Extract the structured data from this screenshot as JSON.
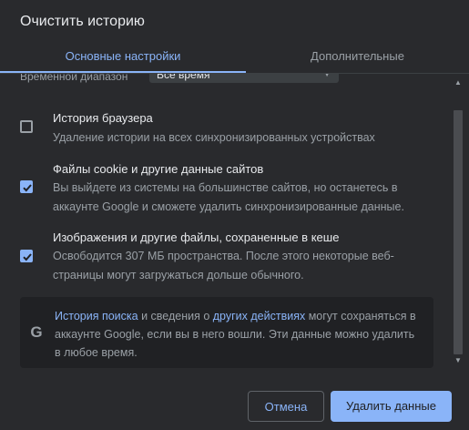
{
  "dialog": {
    "title": "Очистить историю"
  },
  "tabs": {
    "basic": "Основные настройки",
    "advanced": "Дополнительные"
  },
  "time_range": {
    "label": "Временной диапазон",
    "value": "Все время"
  },
  "items": [
    {
      "title": "История браузера",
      "description": "Удаление истории на всех синхронизированных устройствах",
      "checked": false
    },
    {
      "title": "Файлы cookie и другие данные сайтов",
      "description": "Вы выйдете из системы на большинстве сайтов, но останетесь в аккаунте Google и сможете удалить синхронизированные данные.",
      "checked": true
    },
    {
      "title": "Изображения и другие файлы, сохраненные в кеше",
      "description": "Освободится 307 МБ пространства. После этого некоторые веб-страницы могут загружаться дольше обычного.",
      "checked": true
    }
  ],
  "info": {
    "link_search": "История поиска",
    "text_part1": " и сведения о ",
    "link_other": "других действиях",
    "text_part2": " могут сохраняться в аккаунте Google, если вы в него вошли. Эти данные можно удалить в любое время."
  },
  "buttons": {
    "cancel": "Отмена",
    "delete": "Удалить данные"
  },
  "colors": {
    "accent": "#8ab4f8",
    "background": "#292a2d",
    "text_primary": "#e8eaed",
    "text_secondary": "#9aa0a6"
  }
}
